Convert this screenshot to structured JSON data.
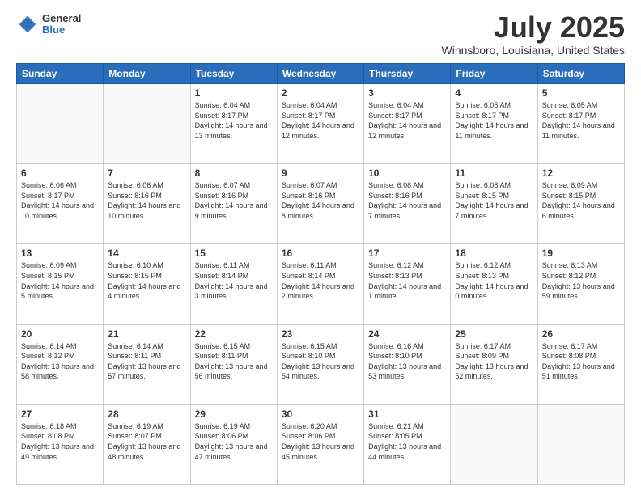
{
  "header": {
    "logo": {
      "general": "General",
      "blue": "Blue"
    },
    "title": "July 2025",
    "subtitle": "Winnsboro, Louisiana, United States"
  },
  "weekdays": [
    "Sunday",
    "Monday",
    "Tuesday",
    "Wednesday",
    "Thursday",
    "Friday",
    "Saturday"
  ],
  "weeks": [
    [
      null,
      null,
      {
        "day": "1",
        "sunrise": "Sunrise: 6:04 AM",
        "sunset": "Sunset: 8:17 PM",
        "daylight": "Daylight: 14 hours and 13 minutes."
      },
      {
        "day": "2",
        "sunrise": "Sunrise: 6:04 AM",
        "sunset": "Sunset: 8:17 PM",
        "daylight": "Daylight: 14 hours and 12 minutes."
      },
      {
        "day": "3",
        "sunrise": "Sunrise: 6:04 AM",
        "sunset": "Sunset: 8:17 PM",
        "daylight": "Daylight: 14 hours and 12 minutes."
      },
      {
        "day": "4",
        "sunrise": "Sunrise: 6:05 AM",
        "sunset": "Sunset: 8:17 PM",
        "daylight": "Daylight: 14 hours and 11 minutes."
      },
      {
        "day": "5",
        "sunrise": "Sunrise: 6:05 AM",
        "sunset": "Sunset: 8:17 PM",
        "daylight": "Daylight: 14 hours and 11 minutes."
      }
    ],
    [
      {
        "day": "6",
        "sunrise": "Sunrise: 6:06 AM",
        "sunset": "Sunset: 8:17 PM",
        "daylight": "Daylight: 14 hours and 10 minutes."
      },
      {
        "day": "7",
        "sunrise": "Sunrise: 6:06 AM",
        "sunset": "Sunset: 8:16 PM",
        "daylight": "Daylight: 14 hours and 10 minutes."
      },
      {
        "day": "8",
        "sunrise": "Sunrise: 6:07 AM",
        "sunset": "Sunset: 8:16 PM",
        "daylight": "Daylight: 14 hours and 9 minutes."
      },
      {
        "day": "9",
        "sunrise": "Sunrise: 6:07 AM",
        "sunset": "Sunset: 8:16 PM",
        "daylight": "Daylight: 14 hours and 8 minutes."
      },
      {
        "day": "10",
        "sunrise": "Sunrise: 6:08 AM",
        "sunset": "Sunset: 8:16 PM",
        "daylight": "Daylight: 14 hours and 7 minutes."
      },
      {
        "day": "11",
        "sunrise": "Sunrise: 6:08 AM",
        "sunset": "Sunset: 8:15 PM",
        "daylight": "Daylight: 14 hours and 7 minutes."
      },
      {
        "day": "12",
        "sunrise": "Sunrise: 6:09 AM",
        "sunset": "Sunset: 8:15 PM",
        "daylight": "Daylight: 14 hours and 6 minutes."
      }
    ],
    [
      {
        "day": "13",
        "sunrise": "Sunrise: 6:09 AM",
        "sunset": "Sunset: 8:15 PM",
        "daylight": "Daylight: 14 hours and 5 minutes."
      },
      {
        "day": "14",
        "sunrise": "Sunrise: 6:10 AM",
        "sunset": "Sunset: 8:15 PM",
        "daylight": "Daylight: 14 hours and 4 minutes."
      },
      {
        "day": "15",
        "sunrise": "Sunrise: 6:11 AM",
        "sunset": "Sunset: 8:14 PM",
        "daylight": "Daylight: 14 hours and 3 minutes."
      },
      {
        "day": "16",
        "sunrise": "Sunrise: 6:11 AM",
        "sunset": "Sunset: 8:14 PM",
        "daylight": "Daylight: 14 hours and 2 minutes."
      },
      {
        "day": "17",
        "sunrise": "Sunrise: 6:12 AM",
        "sunset": "Sunset: 8:13 PM",
        "daylight": "Daylight: 14 hours and 1 minute."
      },
      {
        "day": "18",
        "sunrise": "Sunrise: 6:12 AM",
        "sunset": "Sunset: 8:13 PM",
        "daylight": "Daylight: 14 hours and 0 minutes."
      },
      {
        "day": "19",
        "sunrise": "Sunrise: 6:13 AM",
        "sunset": "Sunset: 8:12 PM",
        "daylight": "Daylight: 13 hours and 59 minutes."
      }
    ],
    [
      {
        "day": "20",
        "sunrise": "Sunrise: 6:14 AM",
        "sunset": "Sunset: 8:12 PM",
        "daylight": "Daylight: 13 hours and 58 minutes."
      },
      {
        "day": "21",
        "sunrise": "Sunrise: 6:14 AM",
        "sunset": "Sunset: 8:11 PM",
        "daylight": "Daylight: 13 hours and 57 minutes."
      },
      {
        "day": "22",
        "sunrise": "Sunrise: 6:15 AM",
        "sunset": "Sunset: 8:11 PM",
        "daylight": "Daylight: 13 hours and 56 minutes."
      },
      {
        "day": "23",
        "sunrise": "Sunrise: 6:15 AM",
        "sunset": "Sunset: 8:10 PM",
        "daylight": "Daylight: 13 hours and 54 minutes."
      },
      {
        "day": "24",
        "sunrise": "Sunrise: 6:16 AM",
        "sunset": "Sunset: 8:10 PM",
        "daylight": "Daylight: 13 hours and 53 minutes."
      },
      {
        "day": "25",
        "sunrise": "Sunrise: 6:17 AM",
        "sunset": "Sunset: 8:09 PM",
        "daylight": "Daylight: 13 hours and 52 minutes."
      },
      {
        "day": "26",
        "sunrise": "Sunrise: 6:17 AM",
        "sunset": "Sunset: 8:08 PM",
        "daylight": "Daylight: 13 hours and 51 minutes."
      }
    ],
    [
      {
        "day": "27",
        "sunrise": "Sunrise: 6:18 AM",
        "sunset": "Sunset: 8:08 PM",
        "daylight": "Daylight: 13 hours and 49 minutes."
      },
      {
        "day": "28",
        "sunrise": "Sunrise: 6:19 AM",
        "sunset": "Sunset: 8:07 PM",
        "daylight": "Daylight: 13 hours and 48 minutes."
      },
      {
        "day": "29",
        "sunrise": "Sunrise: 6:19 AM",
        "sunset": "Sunset: 8:06 PM",
        "daylight": "Daylight: 13 hours and 47 minutes."
      },
      {
        "day": "30",
        "sunrise": "Sunrise: 6:20 AM",
        "sunset": "Sunset: 8:06 PM",
        "daylight": "Daylight: 13 hours and 45 minutes."
      },
      {
        "day": "31",
        "sunrise": "Sunrise: 6:21 AM",
        "sunset": "Sunset: 8:05 PM",
        "daylight": "Daylight: 13 hours and 44 minutes."
      },
      null,
      null
    ]
  ]
}
